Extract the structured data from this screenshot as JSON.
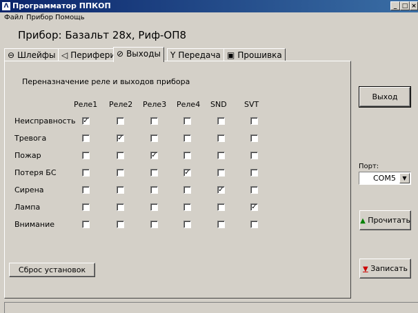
{
  "window": {
    "title": "Программатор ППКОП",
    "app_icon": "app-logo-icon",
    "controls": [
      "minimize-icon",
      "maximize-icon",
      "close-icon"
    ]
  },
  "menu": {
    "items": [
      "Файл",
      "Прибор",
      "Помощь"
    ]
  },
  "device_title": "Прибор: Базальт 28х, Риф-ОП8",
  "tabs": [
    {
      "label": "Шлейфы",
      "icon": "loop-icon"
    },
    {
      "label": "Периферия",
      "icon": "speaker-icon"
    },
    {
      "label": "Выходы",
      "icon": "outputs-icon"
    },
    {
      "label": "Передача",
      "icon": "antenna-icon"
    },
    {
      "label": "Прошивка",
      "icon": "chip-icon"
    }
  ],
  "active_tab": "Выходы",
  "outputs": {
    "heading": "Переназначение реле и выходов прибора",
    "columns": [
      "Реле1",
      "Реле2",
      "Реле3",
      "Реле4",
      "SND",
      "SVT"
    ],
    "rows": [
      {
        "label": "Неисправность",
        "checked": [
          true,
          false,
          false,
          false,
          false,
          false
        ]
      },
      {
        "label": "Тревога",
        "checked": [
          false,
          true,
          false,
          false,
          false,
          false
        ]
      },
      {
        "label": "Пожар",
        "checked": [
          false,
          false,
          true,
          false,
          false,
          false
        ]
      },
      {
        "label": "Потеря БС",
        "checked": [
          false,
          false,
          false,
          true,
          false,
          false
        ]
      },
      {
        "label": "Сирена",
        "checked": [
          false,
          false,
          false,
          false,
          true,
          false
        ]
      },
      {
        "label": "Лампа",
        "checked": [
          false,
          false,
          false,
          false,
          false,
          true
        ]
      },
      {
        "label": "Внимание",
        "checked": [
          false,
          false,
          false,
          false,
          false,
          false
        ]
      }
    ],
    "reset_button": "Сброс установок"
  },
  "sidebar": {
    "exit_button": "Выход",
    "port_label": "Порт:",
    "port_value": "COM5",
    "read_button": "Прочитать",
    "read_icon": "upload-arrow-icon",
    "write_button": "Записать",
    "write_icon": "download-arrow-icon"
  },
  "colors": {
    "titlebar": "#0a246a",
    "read_icon": "#008000",
    "write_icon": "#cc0000"
  }
}
